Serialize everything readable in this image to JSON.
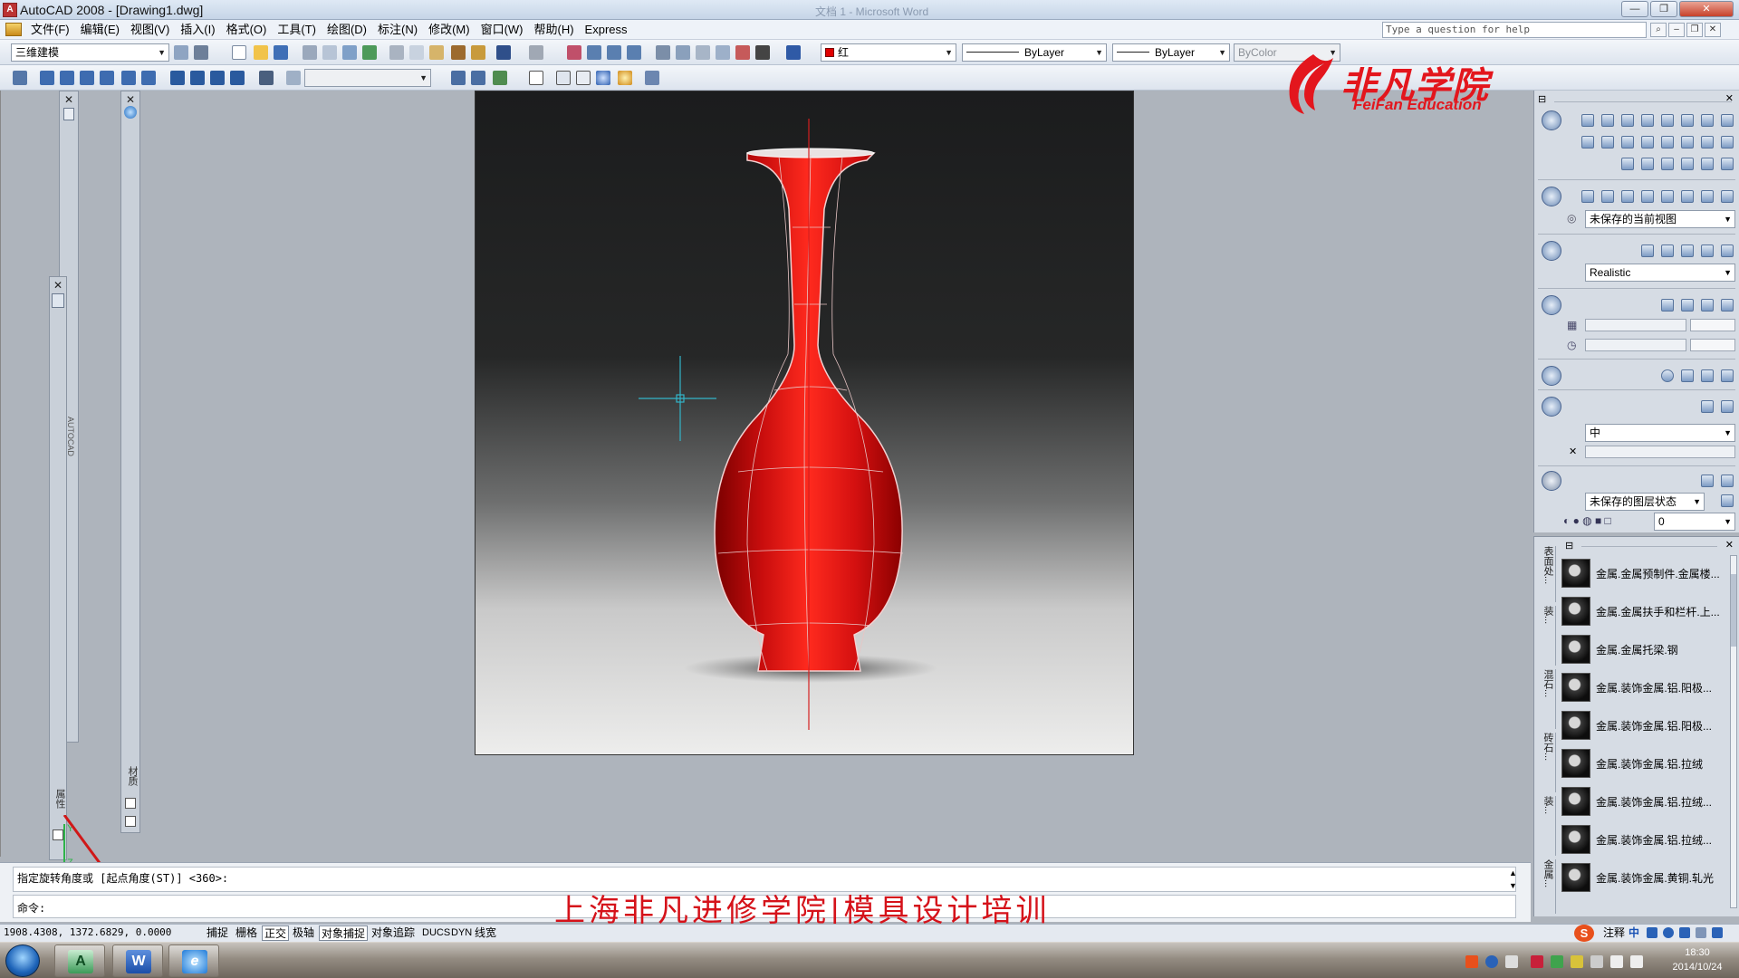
{
  "window": {
    "title": "AutoCAD 2008 - [Drawing1.dwg]",
    "background_title": "文档 1 - Microsoft Word",
    "controls": [
      "—",
      "❐",
      "✕"
    ]
  },
  "menu": {
    "items": [
      "文件(F)",
      "编辑(E)",
      "视图(V)",
      "插入(I)",
      "格式(O)",
      "工具(T)",
      "绘图(D)",
      "标注(N)",
      "修改(M)",
      "窗口(W)",
      "帮助(H)",
      "Express"
    ],
    "help_placeholder": "Type a question for help"
  },
  "toolbar": {
    "workspace": "三维建模",
    "color": "红",
    "color_hex": "#e00000",
    "linetype": "ByLayer",
    "lineweight": "ByLayer",
    "plotstyle": "ByColor"
  },
  "brand": {
    "cn": "非凡学院",
    "en": "FeiFan Education"
  },
  "palettes": {
    "left_strip_1_label": "属性",
    "left_strip_2_label": "材质",
    "left_strip_small_label": "AUTOCAD"
  },
  "dashboard": {
    "view_combo": "未保存的当前视图",
    "visual_style": "Realistic",
    "material_combo": "中",
    "layer_state": "未保存的图层状态",
    "layer_current": "0"
  },
  "tool_palette": {
    "tabs": [
      "表面处...",
      "装...",
      "混石...",
      "砖石...",
      "装...",
      "金属..."
    ],
    "items": [
      "金属.金属预制件.金属楼...",
      "金属.金属扶手和栏杆.上...",
      "金属.金属托梁.钢",
      "金属.装饰金属.铝.阳极...",
      "金属.装饰金属.铝.阳极...",
      "金属.装饰金属.铝.拉绒",
      "金属.装饰金属.铝.拉绒...",
      "金属.装饰金属.铝.拉绒...",
      "金属.装饰金属.黄铜.轧光"
    ]
  },
  "command": {
    "history": "指定旋转角度或 [起点角度(ST)] <360>:",
    "prompt": "命令:"
  },
  "overlay_caption": "上海非凡进修学院|模具设计培训",
  "status": {
    "coords": "1908.4308, 1372.6829, 0.0000",
    "toggles": [
      {
        "label": "捕捉",
        "on": false
      },
      {
        "label": "栅格",
        "on": false
      },
      {
        "label": "正交",
        "on": true
      },
      {
        "label": "极轴",
        "on": false
      },
      {
        "label": "对象捕捉",
        "on": true
      },
      {
        "label": "对象追踪",
        "on": false
      },
      {
        "label": "DUCS",
        "on": false
      },
      {
        "label": "DYN",
        "on": false
      },
      {
        "label": "线宽",
        "on": false
      }
    ],
    "annotation_label": "注释"
  },
  "taskbar": {
    "time": "18:30",
    "date": "2014/10/24",
    "apps": [
      "autocad-app",
      "word-app",
      "ie-app"
    ],
    "ime_label": "中"
  },
  "model": {
    "name": "vase",
    "color": "#d51010"
  }
}
